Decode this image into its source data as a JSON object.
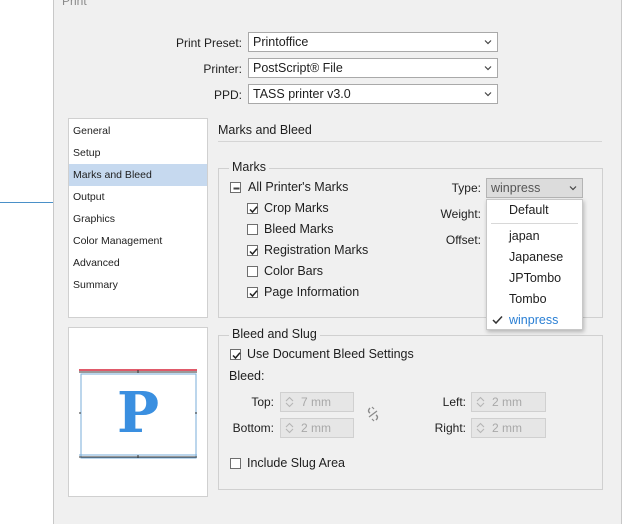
{
  "dialog": {
    "title": "Print"
  },
  "top": {
    "preset_label": "Print Preset:",
    "preset_value": "Printoffice",
    "printer_label": "Printer:",
    "printer_value": "PostScript® File",
    "ppd_label": "PPD:",
    "ppd_value": "TASS printer v3.0"
  },
  "sidebar": {
    "items": [
      {
        "label": "General"
      },
      {
        "label": "Setup"
      },
      {
        "label": "Marks and Bleed"
      },
      {
        "label": "Output"
      },
      {
        "label": "Graphics"
      },
      {
        "label": "Color Management"
      },
      {
        "label": "Advanced"
      },
      {
        "label": "Summary"
      }
    ],
    "selected": "Marks and Bleed"
  },
  "preview": {
    "letter": "P"
  },
  "panel": {
    "title": "Marks and Bleed"
  },
  "marks": {
    "legend": "Marks",
    "all": {
      "label": "All Printer's Marks",
      "state": "mixed"
    },
    "items": [
      {
        "label": "Crop Marks",
        "checked": true
      },
      {
        "label": "Bleed Marks",
        "checked": false
      },
      {
        "label": "Registration Marks",
        "checked": true
      },
      {
        "label": "Color Bars",
        "checked": false
      },
      {
        "label": "Page Information",
        "checked": true
      }
    ],
    "type_label": "Type:",
    "type_value": "winpress",
    "weight_label": "Weight:",
    "offset_label": "Offset:"
  },
  "type_menu": {
    "options": [
      "Default",
      "japan",
      "Japanese",
      "JPTombo",
      "Tombo",
      "winpress"
    ],
    "selected": "winpress"
  },
  "bleed": {
    "legend": "Bleed and Slug",
    "use_doc": {
      "label": "Use Document Bleed Settings",
      "checked": true
    },
    "bleed_label": "Bleed:",
    "top_label": "Top:",
    "top_value": "7 mm",
    "bottom_label": "Bottom:",
    "bottom_value": "2 mm",
    "left_label": "Left:",
    "left_value": "2 mm",
    "right_label": "Right:",
    "right_value": "2 mm",
    "slug": {
      "label": "Include Slug Area",
      "checked": false
    }
  },
  "colors": {
    "selected_item_bg": "#c6d9ef",
    "accent": "#2a7fd4",
    "preview_letter": "#3a8fe0",
    "bleed_line": "#e05a6a"
  }
}
